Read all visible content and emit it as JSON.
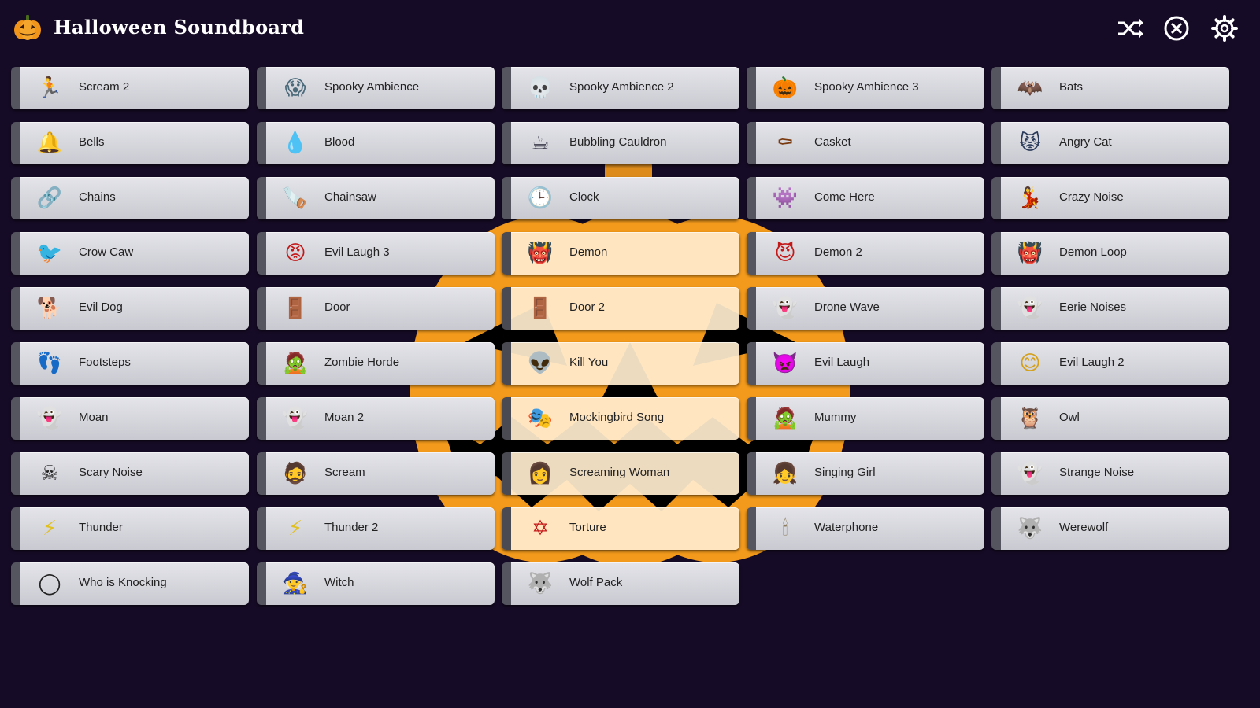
{
  "app": {
    "title": "Halloween Soundboard"
  },
  "colors": {
    "background": "#160b26",
    "button": "#d4d4da",
    "button_edge": "#555560",
    "pumpkin": "#f39a1c",
    "icon_white": "#ffffff"
  },
  "toolbar": {
    "shuffle_icon": "shuffle-icon",
    "stop_icon": "stop-all-icon",
    "settings_icon": "gear-icon"
  },
  "columns": [
    [
      {
        "label": "Scream 2",
        "icon": "running-figure-icon"
      },
      {
        "label": "Bells",
        "icon": "bell-icon"
      },
      {
        "label": "Chains",
        "icon": "chain-icon"
      },
      {
        "label": "Crow Caw",
        "icon": "crow-icon"
      },
      {
        "label": "Evil Dog",
        "icon": "dog-icon"
      },
      {
        "label": "Footsteps",
        "icon": "footprint-icon"
      },
      {
        "label": "Moan",
        "icon": "ghost-face-icon"
      },
      {
        "label": "Scary Noise",
        "icon": "skull-icon"
      },
      {
        "label": "Thunder",
        "icon": "lightning-icon"
      },
      {
        "label": "Who is Knocking",
        "icon": "door-knocker-icon"
      }
    ],
    [
      {
        "label": "Spooky Ambience",
        "icon": "scream-mask-icon"
      },
      {
        "label": "Blood",
        "icon": "blood-drop-icon"
      },
      {
        "label": "Chainsaw",
        "icon": "chainsaw-icon"
      },
      {
        "label": "Evil Laugh 3",
        "icon": "red-face-icon"
      },
      {
        "label": "Door",
        "icon": "door-icon"
      },
      {
        "label": "Zombie Horde",
        "icon": "zombie-icon"
      },
      {
        "label": "Moan 2",
        "icon": "ghost-face-icon"
      },
      {
        "label": "Scream",
        "icon": "face-icon"
      },
      {
        "label": "Thunder 2",
        "icon": "lightning-icon"
      },
      {
        "label": "Witch",
        "icon": "witch-icon"
      }
    ],
    [
      {
        "label": "Spooky Ambience 2",
        "icon": "red-skull-icon"
      },
      {
        "label": "Bubbling Cauldron",
        "icon": "cauldron-icon"
      },
      {
        "label": "Clock",
        "icon": "clock-icon"
      },
      {
        "label": "Demon",
        "icon": "demon-mask-icon"
      },
      {
        "label": "Door 2",
        "icon": "open-door-icon"
      },
      {
        "label": "Kill You",
        "icon": "alien-icon"
      },
      {
        "label": "Mockingbird Song",
        "icon": "hockey-mask-icon"
      },
      {
        "label": "Screaming Woman",
        "icon": "woman-icon"
      },
      {
        "label": "Torture",
        "icon": "pentagram-icon"
      },
      {
        "label": "Wolf Pack",
        "icon": "wolf-icon"
      }
    ],
    [
      {
        "label": "Spooky Ambience 3",
        "icon": "jack-o-lantern-icon"
      },
      {
        "label": "Casket",
        "icon": "coffin-icon"
      },
      {
        "label": "Come Here",
        "icon": "monster-icon"
      },
      {
        "label": "Demon 2",
        "icon": "devil-head-icon"
      },
      {
        "label": "Drone Wave",
        "icon": "ghost-icon"
      },
      {
        "label": "Evil Laugh",
        "icon": "devil-face-icon"
      },
      {
        "label": "Mummy",
        "icon": "mummy-icon"
      },
      {
        "label": "Singing Girl",
        "icon": "girl-icon"
      },
      {
        "label": "Waterphone",
        "icon": "waterphone-icon"
      }
    ],
    [
      {
        "label": "Bats",
        "icon": "bat-icon"
      },
      {
        "label": "Angry Cat",
        "icon": "cat-icon"
      },
      {
        "label": "Crazy Noise",
        "icon": "dancing-figure-icon"
      },
      {
        "label": "Demon Loop",
        "icon": "horned-face-icon"
      },
      {
        "label": "Eerie Noises",
        "icon": "ghost-icon"
      },
      {
        "label": "Evil Laugh 2",
        "icon": "smiley-icon"
      },
      {
        "label": "Owl",
        "icon": "owl-icon"
      },
      {
        "label": "Strange Noise",
        "icon": "ghost-icon"
      },
      {
        "label": "Werewolf",
        "icon": "werewolf-icon"
      }
    ]
  ]
}
